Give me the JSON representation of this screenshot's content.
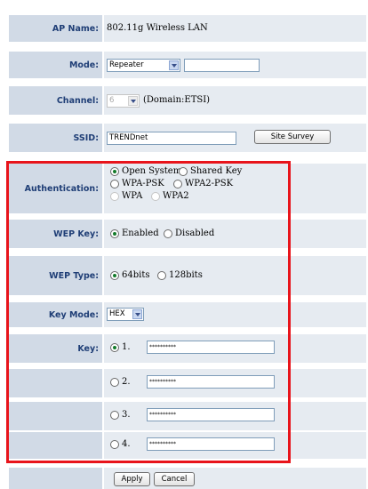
{
  "ap_name": {
    "label": "AP Name:",
    "value": "802.11g Wireless LAN"
  },
  "mode": {
    "label": "Mode:",
    "selected": "Repeater",
    "text_value": ""
  },
  "channel": {
    "label": "Channel:",
    "selected": "6",
    "domain_text": "(Domain:ETSI)"
  },
  "ssid": {
    "label": "SSID:",
    "value": "TRENDnet",
    "site_survey_label": "Site Survey"
  },
  "authentication": {
    "label": "Authentication:",
    "options": [
      "Open System",
      "Shared Key",
      "WPA-PSK",
      "WPA2-PSK",
      "WPA",
      "WPA2"
    ],
    "selected": "Open System"
  },
  "wep_key": {
    "label": "WEP Key:",
    "options": [
      "Enabled",
      "Disabled"
    ],
    "selected": "Enabled"
  },
  "wep_type": {
    "label": "WEP Type:",
    "options": [
      "64bits",
      "128bits"
    ],
    "selected": "64bits"
  },
  "key_mode": {
    "label": "Key Mode:",
    "selected": "HEX"
  },
  "keys": {
    "label": "Key:",
    "selected": "1.",
    "items": [
      {
        "index": "1.",
        "value": "**********"
      },
      {
        "index": "2.",
        "value": "**********"
      },
      {
        "index": "3.",
        "value": "**********"
      },
      {
        "index": "4.",
        "value": "**********"
      }
    ]
  },
  "actions": {
    "apply_label": "Apply",
    "cancel_label": "Cancel"
  },
  "colors": {
    "label_bg": "#d1dae6",
    "field_bg": "#e6ebf1",
    "label_text": "#1f3e76",
    "highlight": "#e8141b"
  }
}
